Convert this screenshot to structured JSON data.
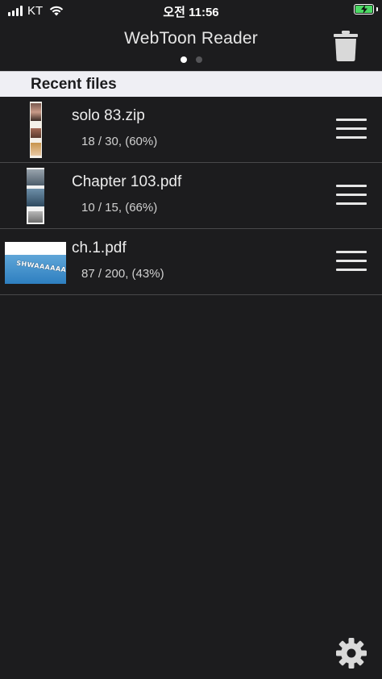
{
  "status_bar": {
    "carrier": "KT",
    "time": "오전 11:56",
    "icons": [
      "signal-icon",
      "wifi-icon",
      "battery-charging-icon"
    ],
    "battery_color": "#4cd964"
  },
  "header": {
    "title": "WebToon Reader",
    "trash_icon": "trash-icon",
    "pages": 2,
    "active_page": 1
  },
  "section": {
    "title": "Recent files"
  },
  "files": [
    {
      "name": "solo 83.zip",
      "progress": "18 / 30, (60%)"
    },
    {
      "name": "Chapter 103.pdf",
      "progress": "10 / 15, (66%)"
    },
    {
      "name": "ch.1.pdf",
      "progress": "87 / 200, (43%)",
      "thumb_text": "SHWAAAAAA"
    }
  ],
  "footer": {
    "settings_icon": "gear-icon"
  },
  "colors": {
    "background": "#1c1c1e",
    "section_header_bg": "#efeff4",
    "divider": "#48484a"
  }
}
